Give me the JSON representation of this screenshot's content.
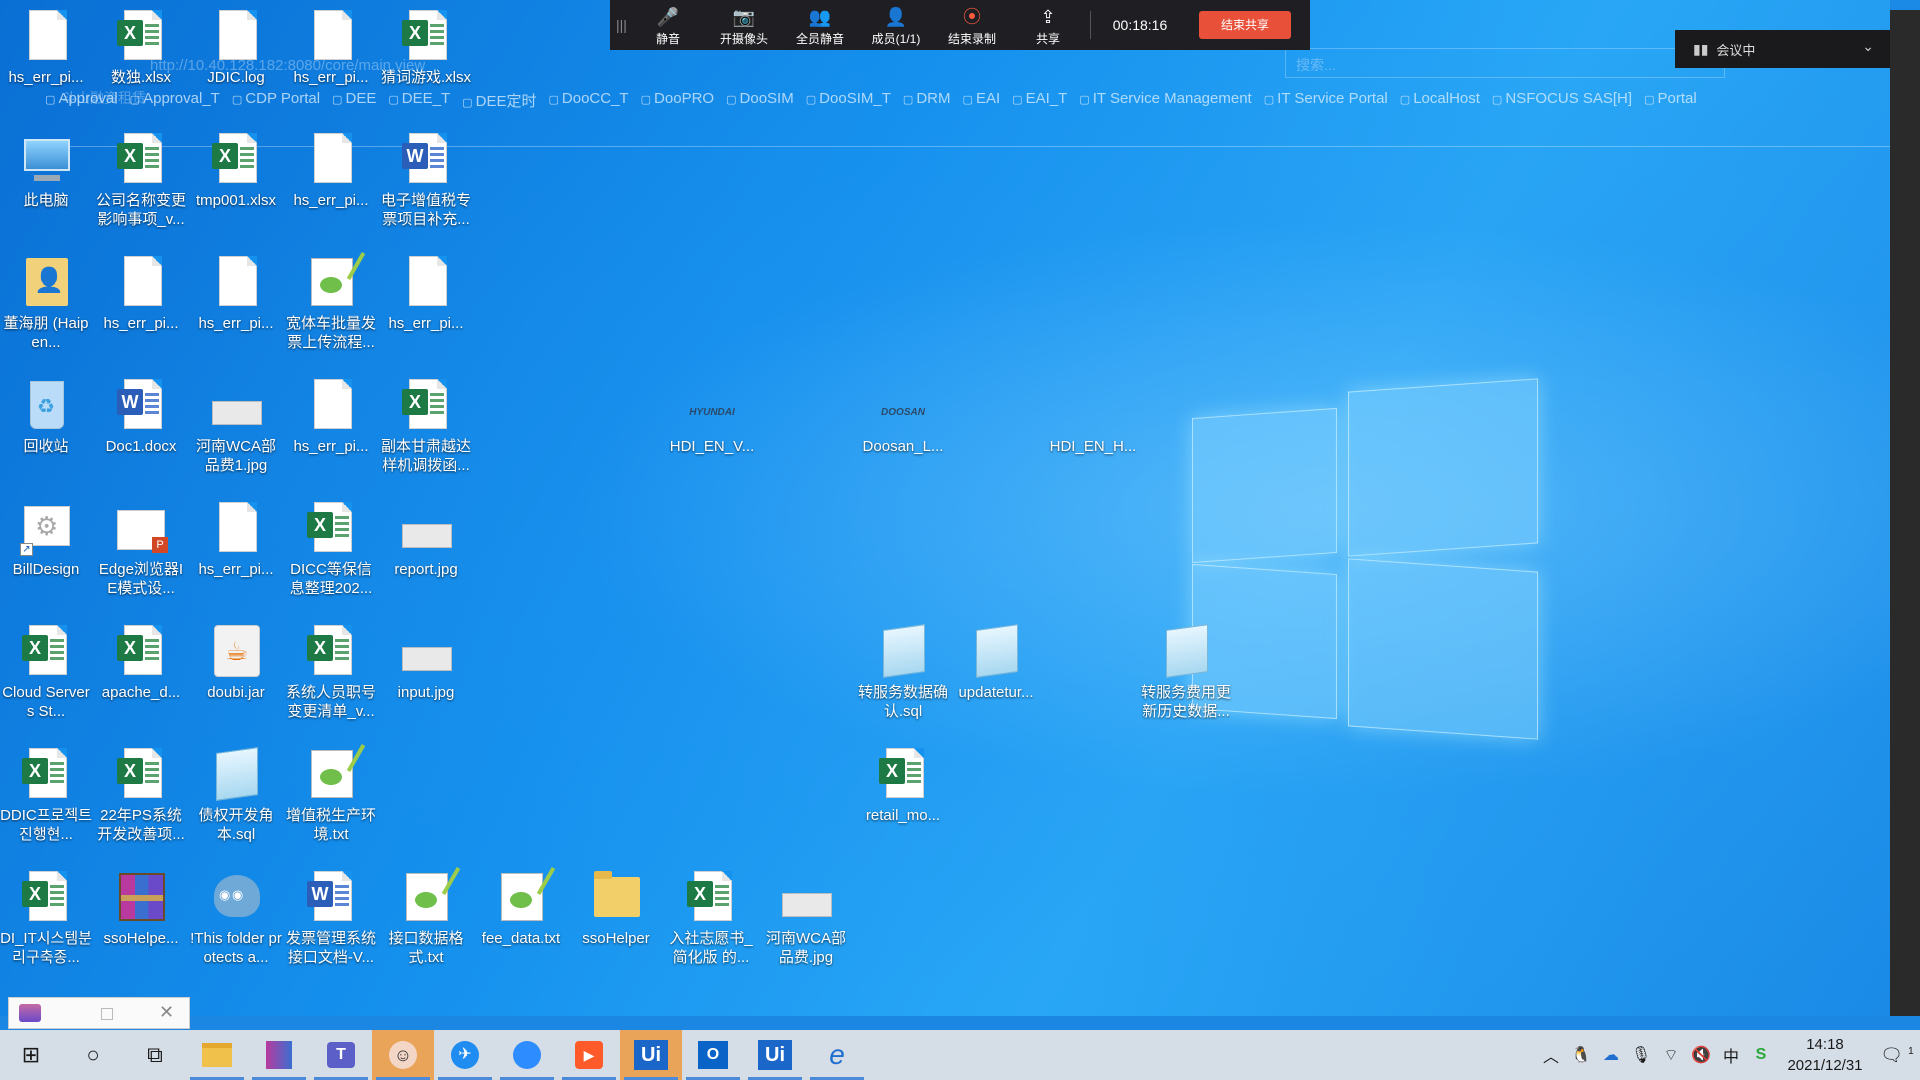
{
  "meeting_bar": {
    "buttons": [
      {
        "label": "静音",
        "icon": "mic-icon",
        "glyph": "🎤"
      },
      {
        "label": "开摄像头",
        "icon": "camera-off-icon",
        "glyph": "📷"
      },
      {
        "label": "全员静音",
        "icon": "mute-all-icon",
        "glyph": "👥"
      },
      {
        "label": "成员(1/1)",
        "icon": "members-icon",
        "glyph": "👤"
      },
      {
        "label": "结束录制",
        "icon": "record-icon",
        "glyph": "⦿"
      },
      {
        "label": "共享",
        "icon": "share-screen-icon",
        "glyph": "⇪"
      }
    ],
    "timer": "00:18:16",
    "end_share_label": "结束共享",
    "end_share_color": "#e8503a"
  },
  "meeting_status": {
    "label": "会议中"
  },
  "ghost_browser": {
    "url": "http://10.40.128.182:8080/core/main.view",
    "tab": "斗山融资租赁",
    "search_placeholder": "搜索...",
    "bookmarks": [
      "Approval",
      "Approval_T",
      "CDP Portal",
      "DEE",
      "DEE_T",
      "DEE定时",
      "DooCC_T",
      "DooPRO",
      "DooSIM",
      "DooSIM_T",
      "DRM",
      "EAI",
      "EAI_T",
      "IT Service Management",
      "IT Service Portal",
      "LocalHost",
      "NSFOCUS SAS[H]",
      "Portal"
    ]
  },
  "desktop_icons": [
    {
      "label": "hs_err_pi...",
      "type": "doc"
    },
    {
      "label": "数独.xlsx",
      "type": "excel"
    },
    {
      "label": "JDIC.log",
      "type": "doc"
    },
    {
      "label": "hs_err_pi...",
      "type": "doc"
    },
    {
      "label": "猜词游戏.xlsx",
      "type": "excel"
    },
    {
      "label": "此电脑",
      "type": "pc"
    },
    {
      "label": "公司名称变更影响事项_v...",
      "type": "excel"
    },
    {
      "label": "tmp001.xlsx",
      "type": "excel"
    },
    {
      "label": "hs_err_pi...",
      "type": "doc"
    },
    {
      "label": "电子增值税专票项目补充...",
      "type": "word"
    },
    {
      "label": "董海朋 (Haipen...",
      "type": "person"
    },
    {
      "label": "hs_err_pi...",
      "type": "doc"
    },
    {
      "label": "hs_err_pi...",
      "type": "doc"
    },
    {
      "label": "宽体车批量发票上传流程...",
      "type": "notepadtool"
    },
    {
      "label": "hs_err_pi...",
      "type": "doc"
    },
    {
      "label": "回收站",
      "type": "bin"
    },
    {
      "label": "Doc1.docx",
      "type": "word"
    },
    {
      "label": "河南WCA部品费1.jpg",
      "type": "jpg"
    },
    {
      "label": "hs_err_pi...",
      "type": "doc"
    },
    {
      "label": "副本甘肃越达样机调拨函...",
      "type": "excel"
    },
    {
      "label": "BillDesign",
      "type": "gear"
    },
    {
      "label": "Edge浏览器IE模式设...",
      "type": "ppt"
    },
    {
      "label": "hs_err_pi...",
      "type": "doc"
    },
    {
      "label": "DICC等保信息整理202...",
      "type": "excel"
    },
    {
      "label": "report.jpg",
      "type": "jpg"
    },
    {
      "label": "Cloud Servers St...",
      "type": "excel"
    },
    {
      "label": "apache_d...",
      "type": "excel"
    },
    {
      "label": "doubi.jar",
      "type": "java"
    },
    {
      "label": "系统人员职号变更清单_v...",
      "type": "excel"
    },
    {
      "label": "input.jpg",
      "type": "jpg"
    },
    {
      "label": "DDIC프로젝트 진행현...",
      "type": "excel"
    },
    {
      "label": "22年PS系统开发改善项...",
      "type": "excel"
    },
    {
      "label": "债权开发角本.sql",
      "type": "notepad"
    },
    {
      "label": "增值税生产环境.txt",
      "type": "notepadtool"
    },
    {
      "label": "DI_IT시스템분리구축종...",
      "type": "excel"
    },
    {
      "label": "ssoHelpe...",
      "type": "rar"
    },
    {
      "label": "!This folder protects a...",
      "type": "owl"
    },
    {
      "label": "发票管理系统接口文档-V...",
      "type": "word"
    },
    {
      "label": "接口数据格式.txt",
      "type": "notepadtool"
    },
    {
      "label": "fee_data.txt",
      "type": "notepadtool"
    },
    {
      "label": "ssoHelper",
      "type": "folder"
    },
    {
      "label": "入社志愿书_简化版 的...",
      "type": "excel"
    },
    {
      "label": "河南WCA部品费.jpg",
      "type": "jpg"
    },
    {
      "label": "HDI_EN_V...",
      "type": "logo",
      "logo_text": "HYUNDAI"
    },
    {
      "label": "Doosan_L...",
      "type": "logo",
      "logo_text": "DOOSAN"
    },
    {
      "label": "HDI_EN_H...",
      "type": "logo",
      "logo_text": ""
    },
    {
      "label": "转服务数据确认.sql",
      "type": "notepad"
    },
    {
      "label": "updatetur...",
      "type": "notepad"
    },
    {
      "label": "转服务费用更新历史数据...",
      "type": "notepad"
    },
    {
      "label": "retail_mo...",
      "type": "excel"
    }
  ],
  "taskbar": {
    "items": [
      {
        "name": "start-button",
        "glyph": "⊞"
      },
      {
        "name": "search-button",
        "glyph": "○"
      },
      {
        "name": "task-view-button",
        "glyph": "⧉"
      },
      {
        "name": "file-explorer-app",
        "glyph": ""
      },
      {
        "name": "app-winrar",
        "glyph": "▤"
      },
      {
        "name": "app-teams",
        "glyph": "T"
      },
      {
        "name": "app-avatar",
        "glyph": "☺"
      },
      {
        "name": "app-dingtalk",
        "glyph": "✈"
      },
      {
        "name": "app-zoom",
        "glyph": "●"
      },
      {
        "name": "app-meeting",
        "glyph": "▶"
      },
      {
        "name": "app-uipath-1",
        "glyph": "Ui"
      },
      {
        "name": "app-outlook",
        "glyph": "O"
      },
      {
        "name": "app-uipath-2",
        "glyph": "Ui"
      },
      {
        "name": "app-ie",
        "glyph": "e"
      }
    ],
    "tray": {
      "ime": "中",
      "time": "14:18",
      "date": "2021/12/31",
      "notifications": "1"
    }
  }
}
